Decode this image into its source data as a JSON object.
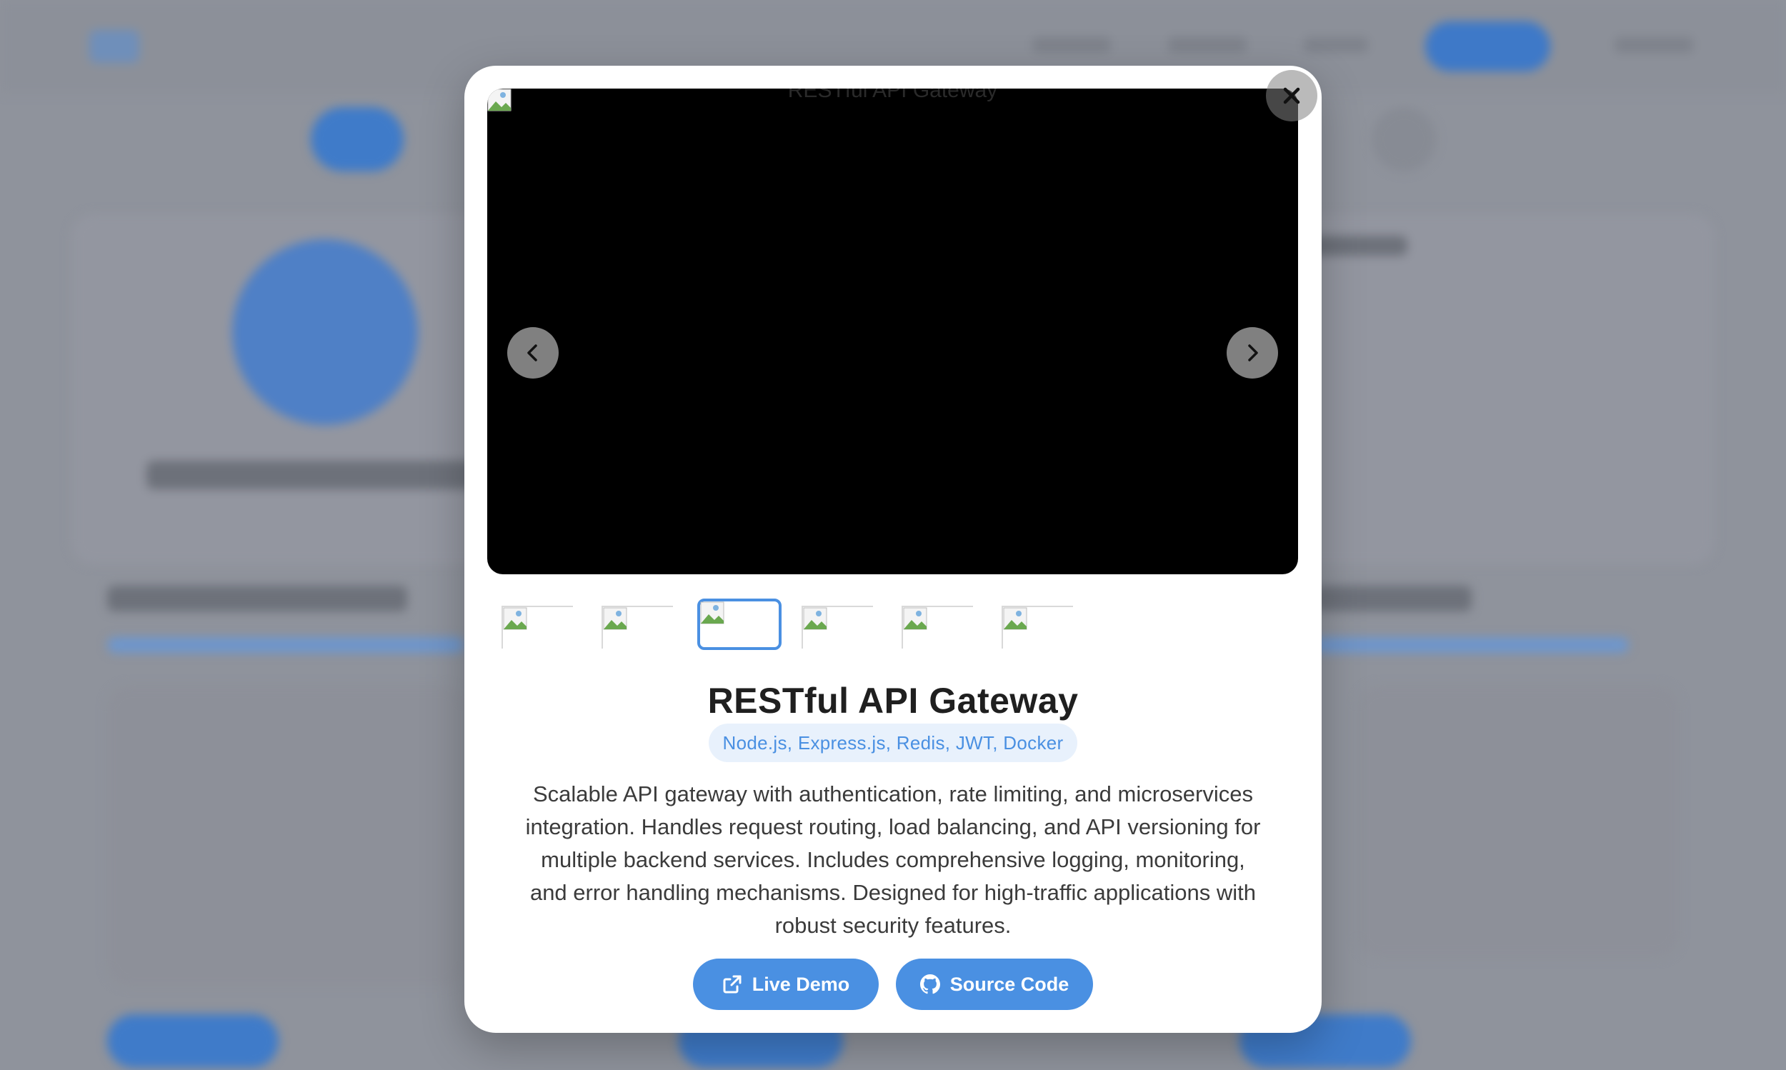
{
  "modal": {
    "viewer": {
      "image_alt": "RESTful API Gateway",
      "prev_icon": "chevron-left-icon",
      "next_icon": "chevron-right-icon"
    },
    "close_icon": "close-icon",
    "thumbnails": {
      "count": 6,
      "active_index": 2
    },
    "title": "RESTful API Gateway",
    "tech_stack": "Node.js, Express.js, Redis, JWT, Docker",
    "description": "Scalable API gateway with authentication, rate limiting, and microservices integration. Handles request routing, load balancing, and API versioning for multiple backend services. Includes comprehensive logging, monitoring, and error handling mechanisms. Designed for high-traffic applications with robust security features.",
    "buttons": {
      "live_demo": {
        "label": "Live Demo",
        "icon": "external-link-icon"
      },
      "source_code": {
        "label": "Source Code",
        "icon": "github-icon"
      }
    }
  },
  "colors": {
    "accent": "#4a90e2",
    "badge_bg": "#e8f1fc",
    "overlay": "#8f939c"
  }
}
